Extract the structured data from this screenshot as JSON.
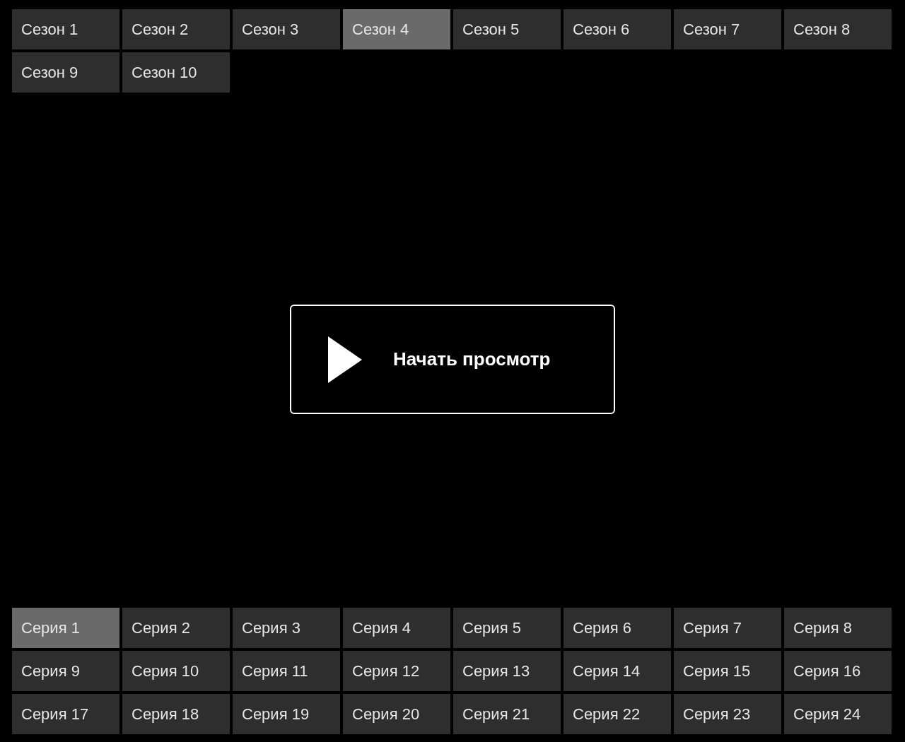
{
  "seasons": [
    {
      "label": "Сезон 1",
      "selected": false
    },
    {
      "label": "Сезон 2",
      "selected": false
    },
    {
      "label": "Сезон 3",
      "selected": false
    },
    {
      "label": "Сезон 4",
      "selected": true
    },
    {
      "label": "Сезон 5",
      "selected": false
    },
    {
      "label": "Сезон 6",
      "selected": false
    },
    {
      "label": "Сезон 7",
      "selected": false
    },
    {
      "label": "Сезон 8",
      "selected": false
    },
    {
      "label": "Сезон 9",
      "selected": false
    },
    {
      "label": "Сезон 10",
      "selected": false
    }
  ],
  "play_button": {
    "label": "Начать просмотр"
  },
  "episodes": [
    {
      "label": "Серия 1",
      "selected": true
    },
    {
      "label": "Серия 2",
      "selected": false
    },
    {
      "label": "Серия 3",
      "selected": false
    },
    {
      "label": "Серия 4",
      "selected": false
    },
    {
      "label": "Серия 5",
      "selected": false
    },
    {
      "label": "Серия 6",
      "selected": false
    },
    {
      "label": "Серия 7",
      "selected": false
    },
    {
      "label": "Серия 8",
      "selected": false
    },
    {
      "label": "Серия 9",
      "selected": false
    },
    {
      "label": "Серия 10",
      "selected": false
    },
    {
      "label": "Серия 11",
      "selected": false
    },
    {
      "label": "Серия 12",
      "selected": false
    },
    {
      "label": "Серия 13",
      "selected": false
    },
    {
      "label": "Серия 14",
      "selected": false
    },
    {
      "label": "Серия 15",
      "selected": false
    },
    {
      "label": "Серия 16",
      "selected": false
    },
    {
      "label": "Серия 17",
      "selected": false
    },
    {
      "label": "Серия 18",
      "selected": false
    },
    {
      "label": "Серия 19",
      "selected": false
    },
    {
      "label": "Серия 20",
      "selected": false
    },
    {
      "label": "Серия 21",
      "selected": false
    },
    {
      "label": "Серия 22",
      "selected": false
    },
    {
      "label": "Серия 23",
      "selected": false
    },
    {
      "label": "Серия 24",
      "selected": false
    }
  ]
}
